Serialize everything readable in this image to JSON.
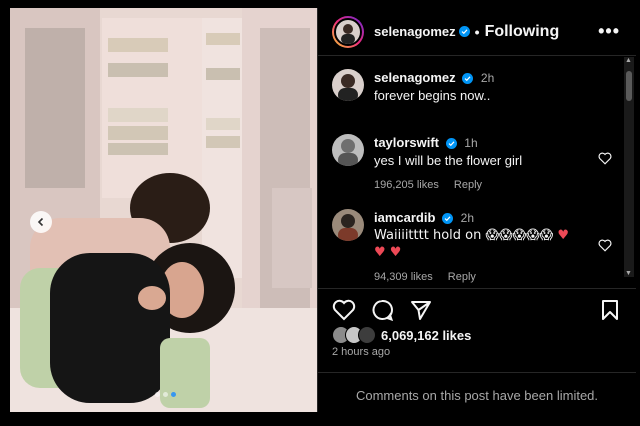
{
  "post": {
    "username": "selenagomez",
    "separator": "•",
    "follow_status": "Following",
    "more": "•••"
  },
  "comments": [
    {
      "user": "selenagomez",
      "time": "2h",
      "text": "forever begins now.."
    },
    {
      "user": "taylorswift",
      "time": "1h",
      "text": "yes I will be the flower girl",
      "likes": "196,205 likes",
      "reply": "Reply"
    },
    {
      "user": "iamcardib",
      "time": "2h",
      "text": "Waiiiitttt hold on 😱😱😱😱😱",
      "text2": "",
      "likes": "94,309 likes",
      "reply": "Reply"
    }
  ],
  "likes_count": "6,069,162 likes",
  "post_time": "2 hours ago",
  "limited_notice": "Comments on this post have been limited.",
  "colors": {
    "verified": "#0095f6",
    "heart": "#ed4956",
    "dot_active": "#3797f0"
  }
}
